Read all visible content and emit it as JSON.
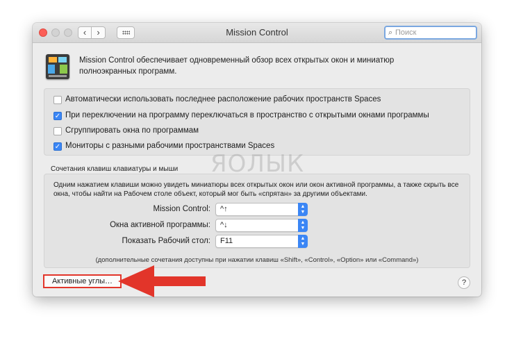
{
  "window": {
    "title": "Mission Control",
    "search": {
      "placeholder": "Поиск",
      "value": ""
    },
    "back_label": "‹",
    "forward_label": "›"
  },
  "description": "Mission Control обеспечивает одновременный обзор всех открытых окон и миниатюр полноэкранных программ.",
  "options": [
    {
      "label": "Автоматически использовать последнее расположение рабочих пространств Spaces",
      "checked": false
    },
    {
      "label": "При переключении на программу переключаться в пространство с открытыми окнами программы",
      "checked": true
    },
    {
      "label": "Сгруппировать окна по программам",
      "checked": false
    },
    {
      "label": "Мониторы с разными рабочими пространствами Spaces",
      "checked": true
    }
  ],
  "shortcuts": {
    "section_title": "Сочетания клавиш клавиатуры и мыши",
    "description": "Одним нажатием клавиши можно увидеть миниатюры всех открытых окон или окон активной программы, а также скрыть все окна, чтобы найти на Рабочем столе объект, который мог быть «спрятан» за другими объектами.",
    "rows": [
      {
        "label": "Mission Control:",
        "value": "^↑"
      },
      {
        "label": "Окна активной программы:",
        "value": "^↓"
      },
      {
        "label": "Показать Рабочий стол:",
        "value": "F11"
      }
    ],
    "note": "(дополнительные сочетания доступны при нажатии клавиш «Shift», «Control», «Option» или «Command»)"
  },
  "hot_corners_label": "Активные углы…",
  "help_label": "?",
  "watermark": "ЯОЛЫК",
  "colors": {
    "accent": "#3b86f5",
    "annotation_arrow": "#e2352a"
  }
}
